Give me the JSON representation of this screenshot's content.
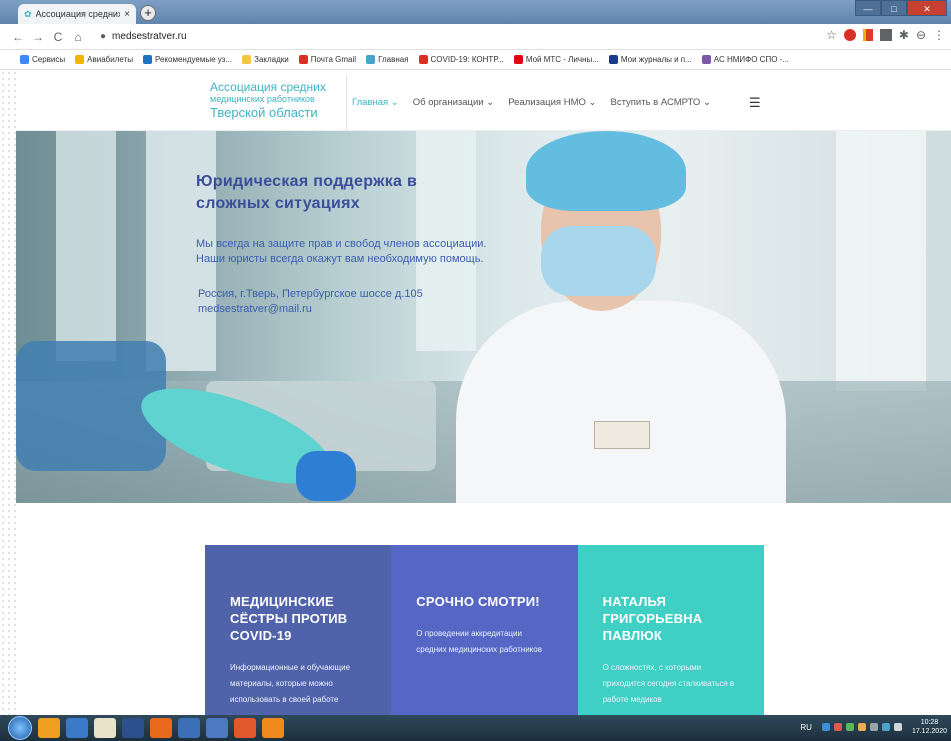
{
  "browser": {
    "tab_title": "Ассоциация средних медицинс",
    "tab_close": "×",
    "new_tab": "+",
    "url": "medsestratver.ru",
    "nav": {
      "back": "←",
      "forward": "→",
      "reload": "C",
      "home": "⌂"
    },
    "star": "☆",
    "profile": "⊖",
    "menu": "⋮",
    "win_minimize": "—",
    "win_maximize": "□",
    "win_close": "✕"
  },
  "bookmarks": [
    {
      "label": "Сервисы",
      "color": "#4285f4"
    },
    {
      "label": "Авиабилеты",
      "color": "#f4b400"
    },
    {
      "label": "Рекомендуемые уз...",
      "color": "#1e73be"
    },
    {
      "label": "Закладки",
      "color": "#f4c542"
    },
    {
      "label": "Почта Gmail",
      "color": "#d93025"
    },
    {
      "label": "Главная",
      "color": "#4aa3c8"
    },
    {
      "label": "COVID-19: КОНТР...",
      "color": "#d93025"
    },
    {
      "label": "Мой МТС - Личны...",
      "color": "#e30611"
    },
    {
      "label": "Мои журналы и п...",
      "color": "#1a3a8f"
    },
    {
      "label": "АС НМИФО СПО -...",
      "color": "#7b5aa6"
    }
  ],
  "site": {
    "logo_line1": "Ассоциация средних",
    "logo_line2": "медицинских работников",
    "logo_line3": "Тверской области",
    "nav": [
      {
        "label": "Главная ⌄",
        "active": true
      },
      {
        "label": "Об организации ⌄",
        "active": false
      },
      {
        "label": "Реализация НМО ⌄",
        "active": false
      },
      {
        "label": "Вступить в АСМРТО ⌄",
        "active": false
      }
    ],
    "burger": "☰"
  },
  "hero": {
    "title_line1": "Юридическая поддержка в",
    "title_line2": "сложных ситуациях",
    "text_line1": "Мы всегда на защите прав и свобод членов ассоциации.",
    "text_line2": "Наши юристы всегда окажут вам необходимую помощь.",
    "address": "Россия, г.Тверь, Петербургское шоссе д.105",
    "email": "medsestratver@mail.ru"
  },
  "cards": [
    {
      "title": "МЕДИЦИНСКИЕ СЁСТРЫ ПРОТИВ COVID-19",
      "text": "Информационные и обучающие материалы, которые можно использовать в своей работе",
      "color": "#4f62aa"
    },
    {
      "title": "СРОЧНО СМОТРИ!",
      "text": "О проведении аккредитации средних медицинских работников",
      "color": "#5566c4"
    },
    {
      "title": "НАТАЛЬЯ ГРИГОРЬЕВНА ПАВЛЮК",
      "text": "О сложностях, с которыми приходится сегодня сталкиваться в работе медиков",
      "color": "#40cfc4"
    }
  ],
  "taskbar": {
    "apps": [
      "#f0a020",
      "#3a78c8",
      "#e8e2c8",
      "#2d4f8c",
      "#e86a1a",
      "#3a6fb8",
      "#4d79c0",
      "#e0582c",
      "#f08a1c"
    ],
    "lang": "RU",
    "time": "10:28",
    "date": "17.12.2020"
  }
}
